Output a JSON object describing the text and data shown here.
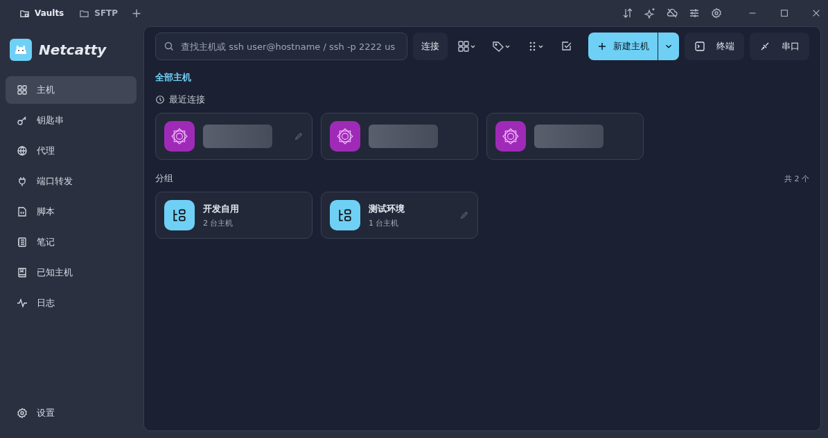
{
  "title_tabs": [
    {
      "label": "Vaults",
      "selected": true
    },
    {
      "label": "SFTP",
      "selected": false
    }
  ],
  "new_tab": "+",
  "brand": "Netcatty",
  "sidebar": {
    "items": [
      {
        "label": "主机",
        "selected": true
      },
      {
        "label": "钥匙串",
        "selected": false
      },
      {
        "label": "代理",
        "selected": false
      },
      {
        "label": "端口转发",
        "selected": false
      },
      {
        "label": "脚本",
        "selected": false
      },
      {
        "label": "笔记",
        "selected": false
      },
      {
        "label": "已知主机",
        "selected": false
      },
      {
        "label": "日志",
        "selected": false
      }
    ],
    "settings": "设置"
  },
  "search": {
    "placeholder": "查找主机或 ssh user@hostname / ssh -p 2222 us"
  },
  "connect_button": "连接",
  "new_host_button": "新建主机",
  "terminal_button": "终端",
  "serial_button": "串口",
  "breadcrumb": "全部主机",
  "recent": {
    "title": "最近连接",
    "hosts": [
      {
        "edit_visible": true
      },
      {
        "edit_visible": false
      },
      {
        "edit_visible": false
      }
    ]
  },
  "groups": {
    "title": "分组",
    "count": "共 2 个",
    "items": [
      {
        "name": "开发自用",
        "subtitle": "2 台主机",
        "edit_visible": false
      },
      {
        "name": "测试环境",
        "subtitle": "1 台主机",
        "edit_visible": true
      }
    ]
  }
}
